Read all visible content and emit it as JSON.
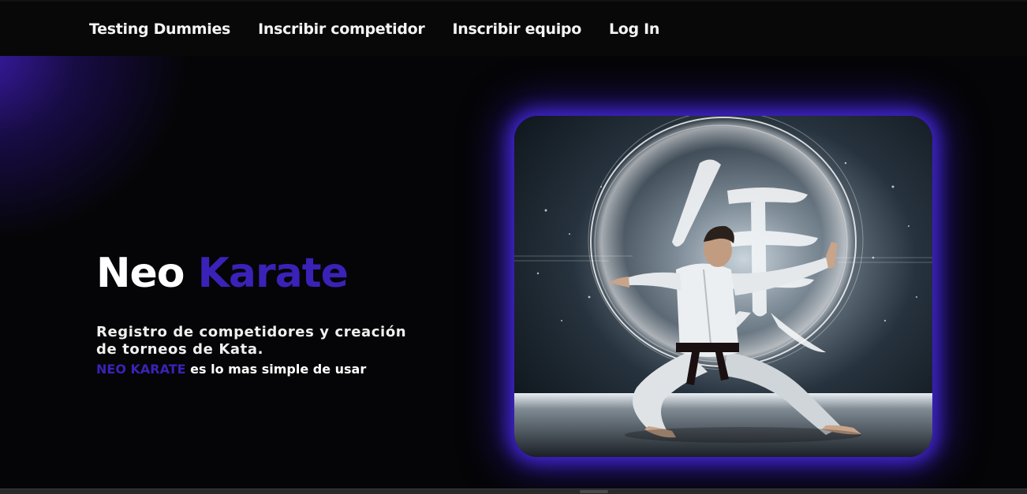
{
  "nav": {
    "items": [
      {
        "label": "Testing Dummies"
      },
      {
        "label": "Inscribir competidor"
      },
      {
        "label": "Inscribir equipo"
      },
      {
        "label": "Log In"
      }
    ]
  },
  "hero": {
    "title_part1": "Neo",
    "title_part2": "Karate",
    "description": "Registro de competidores y creación de torneos de Kata.",
    "tagline_brand": "NEO KARATE",
    "tagline_rest": " es lo mas simple de usar"
  },
  "image": {
    "subject": "karate practitioner in stance with glowing kanji ring"
  },
  "colors": {
    "accent": "#3a22b8",
    "glow": "#4628dc",
    "background": "#050507",
    "navbar": "#080808"
  }
}
